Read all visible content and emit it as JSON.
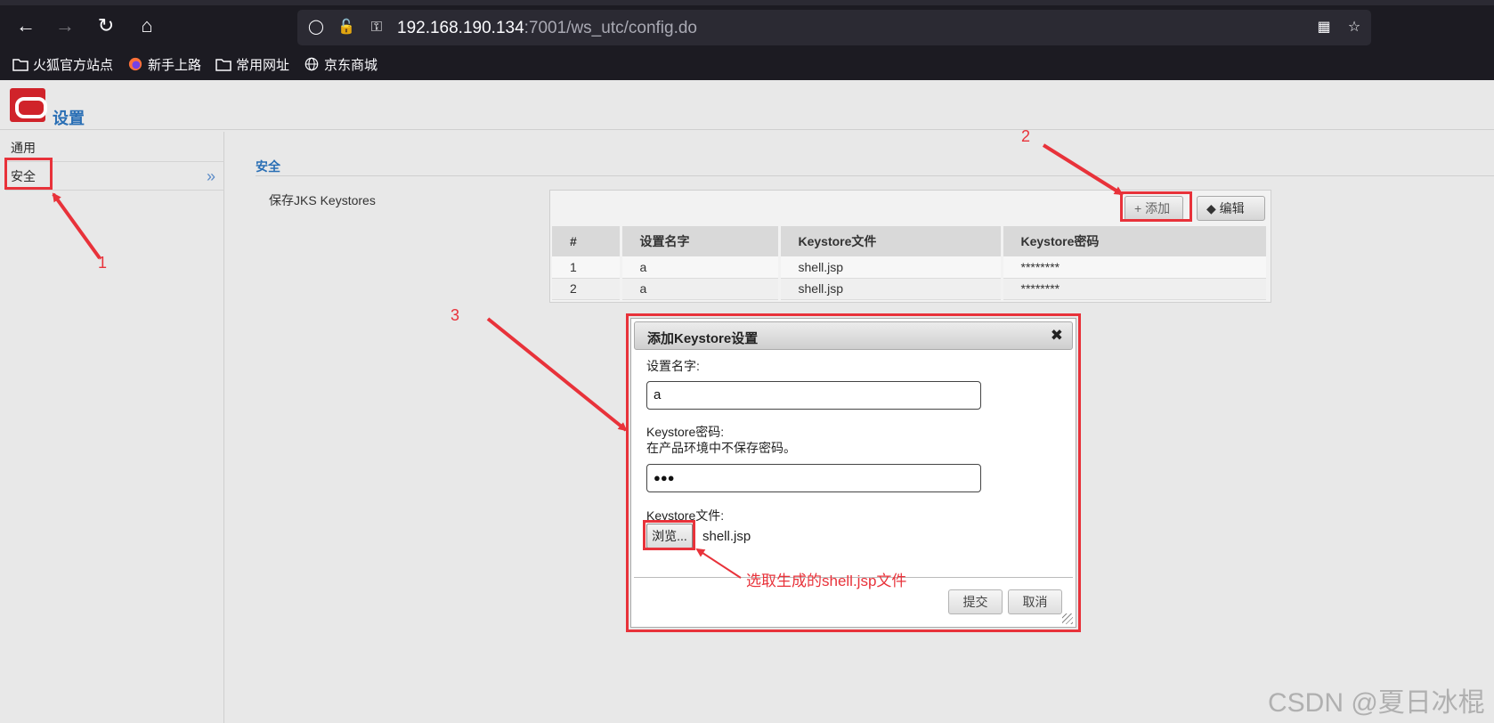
{
  "browser": {
    "url_host": "192.168.190.134",
    "url_rest": ":7001/ws_utc/config.do",
    "bookmarks": [
      {
        "label": "火狐官方站点",
        "icon": "folder-icon"
      },
      {
        "label": "新手上路",
        "icon": "firefox-icon"
      },
      {
        "label": "常用网址",
        "icon": "folder-icon"
      },
      {
        "label": "京东商城",
        "icon": "globe-icon"
      }
    ]
  },
  "header": {
    "title": "设置"
  },
  "sidebar": {
    "items": [
      {
        "label": "通用"
      },
      {
        "label": "安全"
      }
    ]
  },
  "main": {
    "section_title": "安全",
    "keystores_label": "保存JKS Keystores",
    "toolbar": {
      "add_label": "添加",
      "edit_label": "编辑"
    },
    "table": {
      "headers": [
        "#",
        "设置名字",
        "Keystore文件",
        "Keystore密码"
      ],
      "rows": [
        [
          "1",
          "a",
          "shell.jsp",
          "********"
        ],
        [
          "2",
          "a",
          "shell.jsp",
          "********"
        ]
      ]
    }
  },
  "dialog": {
    "title": "添加Keystore设置",
    "name_label": "设置名字:",
    "name_value": "a",
    "password_label": "Keystore密码:",
    "password_note": "在产品环境中不保存密码。",
    "password_value": "●●●",
    "file_label": "Keystore文件:",
    "browse_label": "浏览...",
    "file_name": "shell.jsp",
    "submit_label": "提交",
    "cancel_label": "取消"
  },
  "annotations": {
    "num1": "1",
    "num2": "2",
    "num3": "3",
    "note": "选取生成的shell.jsp文件",
    "color": "#e8323a"
  },
  "watermark": "CSDN @夏日冰棍"
}
